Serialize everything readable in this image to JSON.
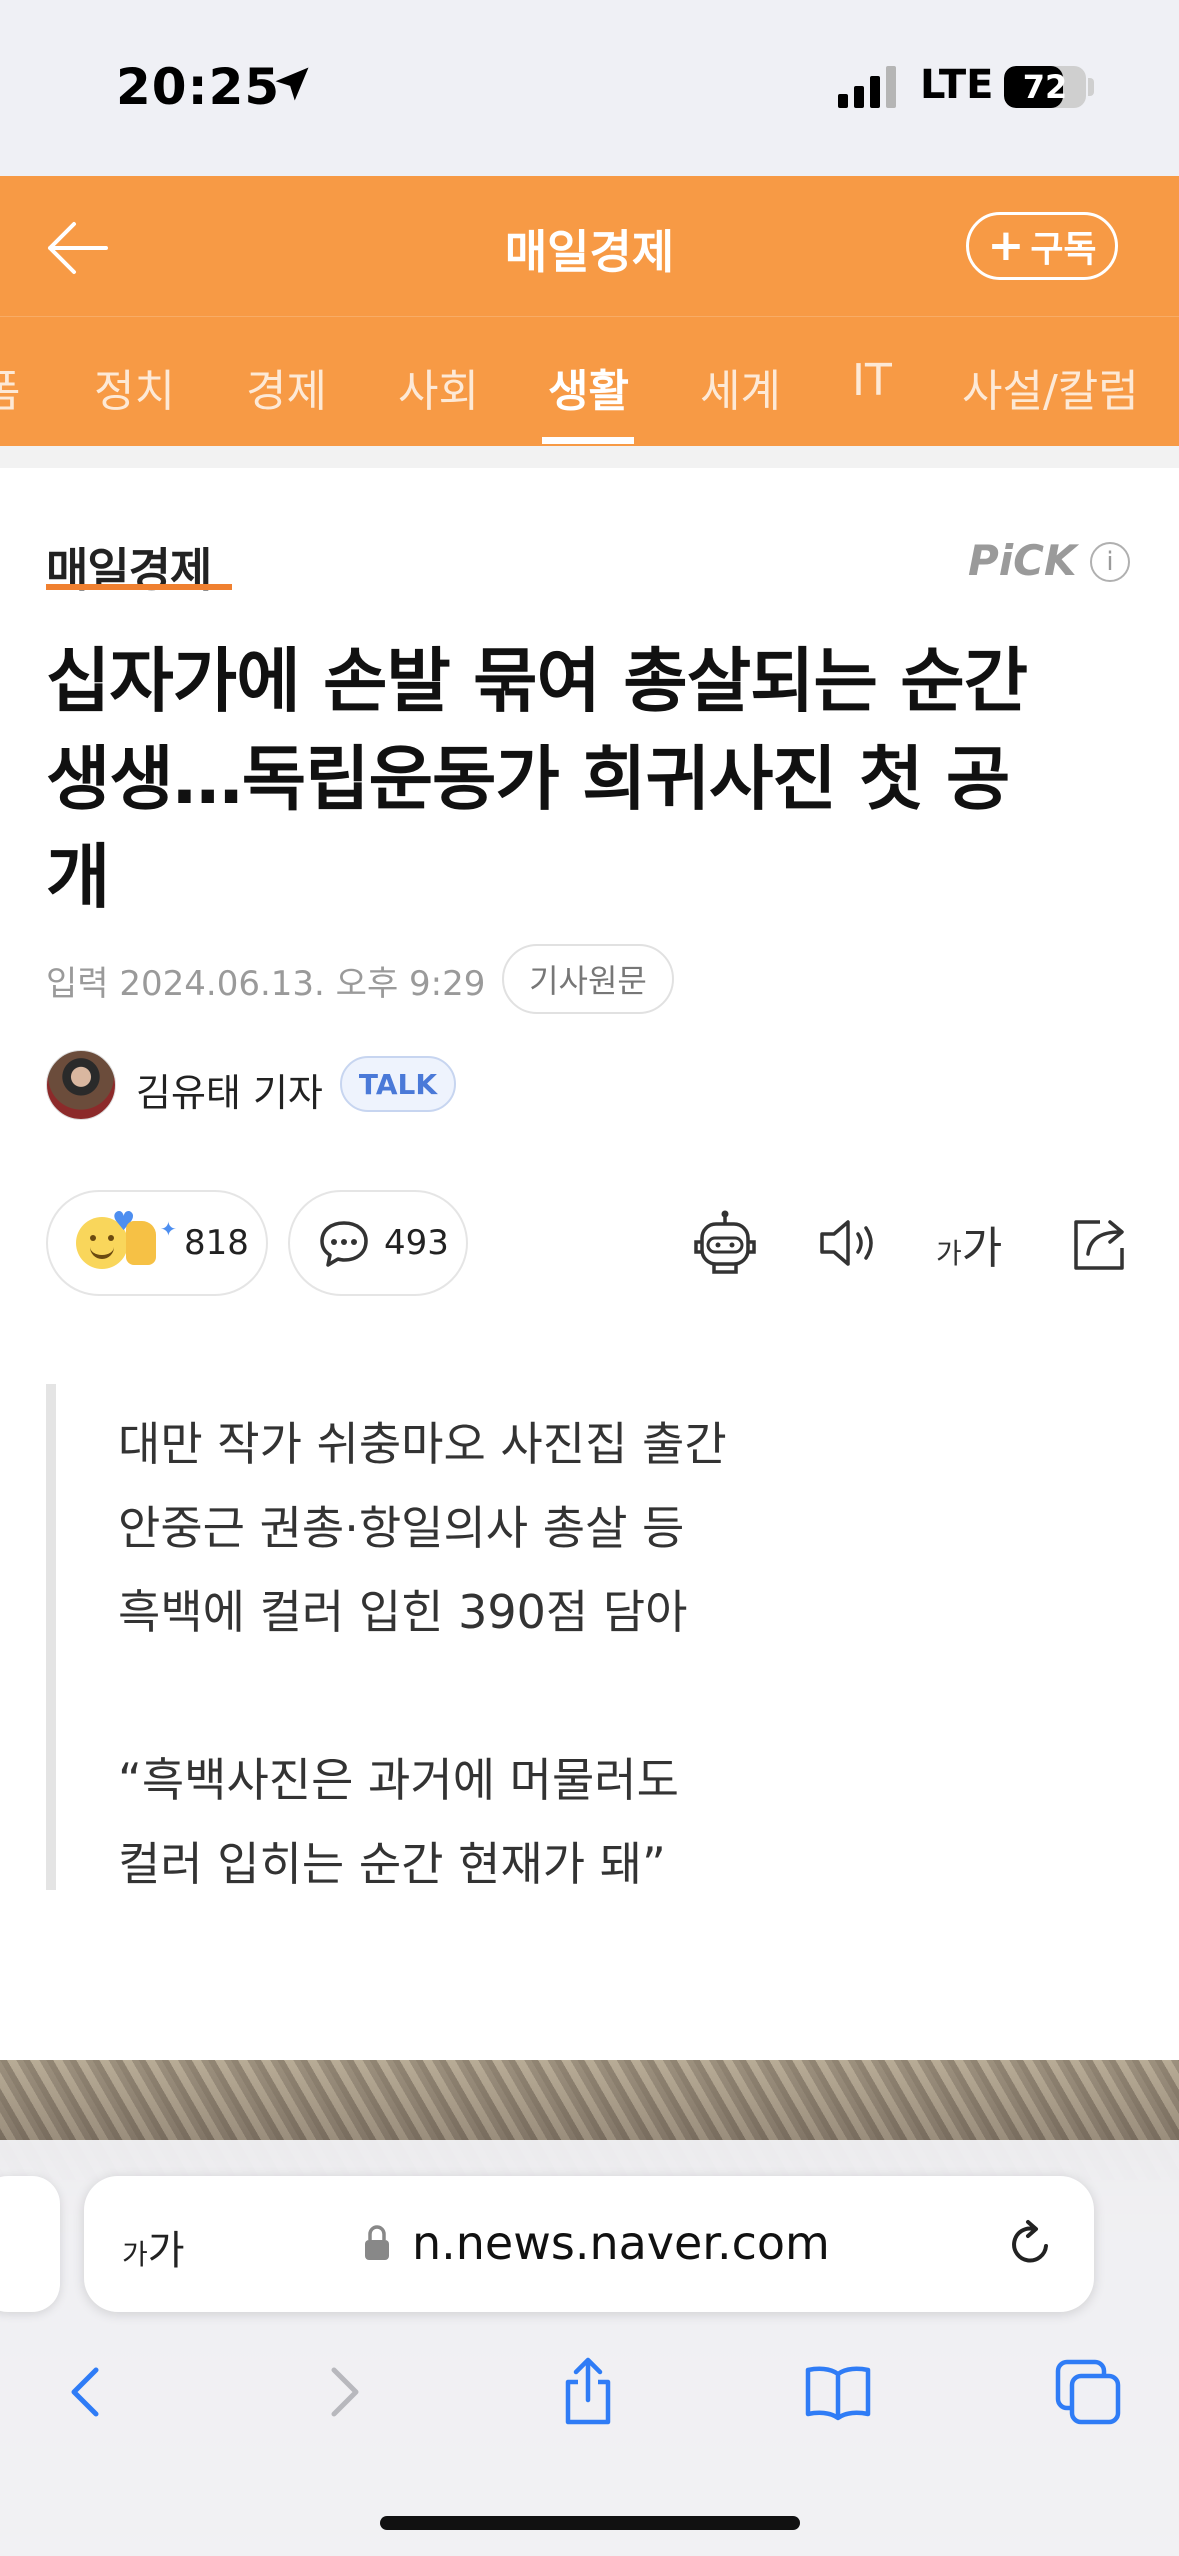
{
  "status_bar": {
    "time": "20:25",
    "network": "LTE",
    "battery": "72",
    "battery_level": 0.72
  },
  "header": {
    "title": "매일경제",
    "subscribe_label": "구독"
  },
  "tabs": [
    "폼",
    "정치",
    "경제",
    "사회",
    "생활",
    "세계",
    "IT",
    "사설/칼럼"
  ],
  "active_tab": "생활",
  "article": {
    "press_name": "매일경제",
    "pick_label": "PiCK",
    "pick_info": "i",
    "headline_lines": [
      "십자가에 손발 묶여 총살되는 순간",
      "생생…독립운동가 희귀사진 첫 공",
      "개"
    ],
    "date_label": "입력",
    "date": "2024.06.13. 오후 9:29",
    "original_label": "기사원문",
    "reporter": "김유태 기자",
    "talk_label": "TALK",
    "reaction_count": "818",
    "comment_count": "493",
    "font_size_small": "가",
    "font_size_big": "가",
    "summary_lines": [
      "대만 작가 쉬충마오 사진집 출간",
      "안중근 권총·항일의사 총살 등",
      "흑백에 컬러 입힌 390점 담아",
      "",
      "“흑백사진은 과거에 머물러도",
      "컬러 입히는 순간 현재가 돼”"
    ]
  },
  "browser": {
    "aa_small": "가",
    "aa_big": "가",
    "url": "n.news.naver.com"
  },
  "icons": {
    "back": "arrow-left-icon",
    "comment": "speech-bubble-icon",
    "ai": "robot-icon",
    "audio": "speaker-icon",
    "share": "share-icon",
    "lock": "lock-icon",
    "reload": "reload-icon"
  },
  "colors": {
    "accent": "#f79a45",
    "press_underline": "#f08030",
    "talk": "#4a79d8",
    "safari_blue": "#2f7cf6"
  }
}
